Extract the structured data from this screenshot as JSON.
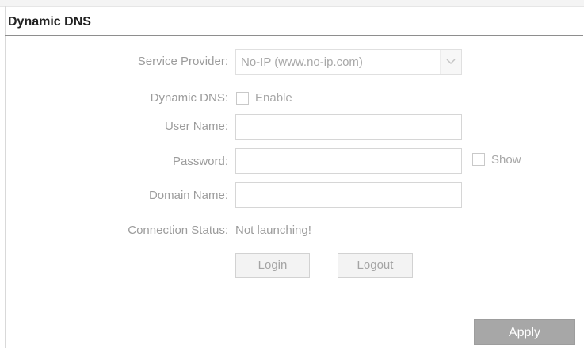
{
  "section": {
    "title": "Dynamic DNS"
  },
  "form": {
    "service_provider": {
      "label": "Service Provider:",
      "value": "No-IP (www.no-ip.com)"
    },
    "dynamic_dns": {
      "label": "Dynamic DNS:",
      "checkbox_label": "Enable",
      "checked": false
    },
    "user_name": {
      "label": "User Name:",
      "value": ""
    },
    "password": {
      "label": "Password:",
      "value": "",
      "show_label": "Show",
      "show_checked": false
    },
    "domain_name": {
      "label": "Domain Name:",
      "value": ""
    },
    "connection_status": {
      "label": "Connection Status:",
      "value": "Not launching!"
    }
  },
  "buttons": {
    "login": "Login",
    "logout": "Logout",
    "apply": "Apply"
  },
  "icons": {
    "select_arrow": "chevron-down-icon"
  },
  "colors": {
    "label": "#9c9c9c",
    "apply_bg": "#a7a7a7",
    "title": "#222222"
  }
}
